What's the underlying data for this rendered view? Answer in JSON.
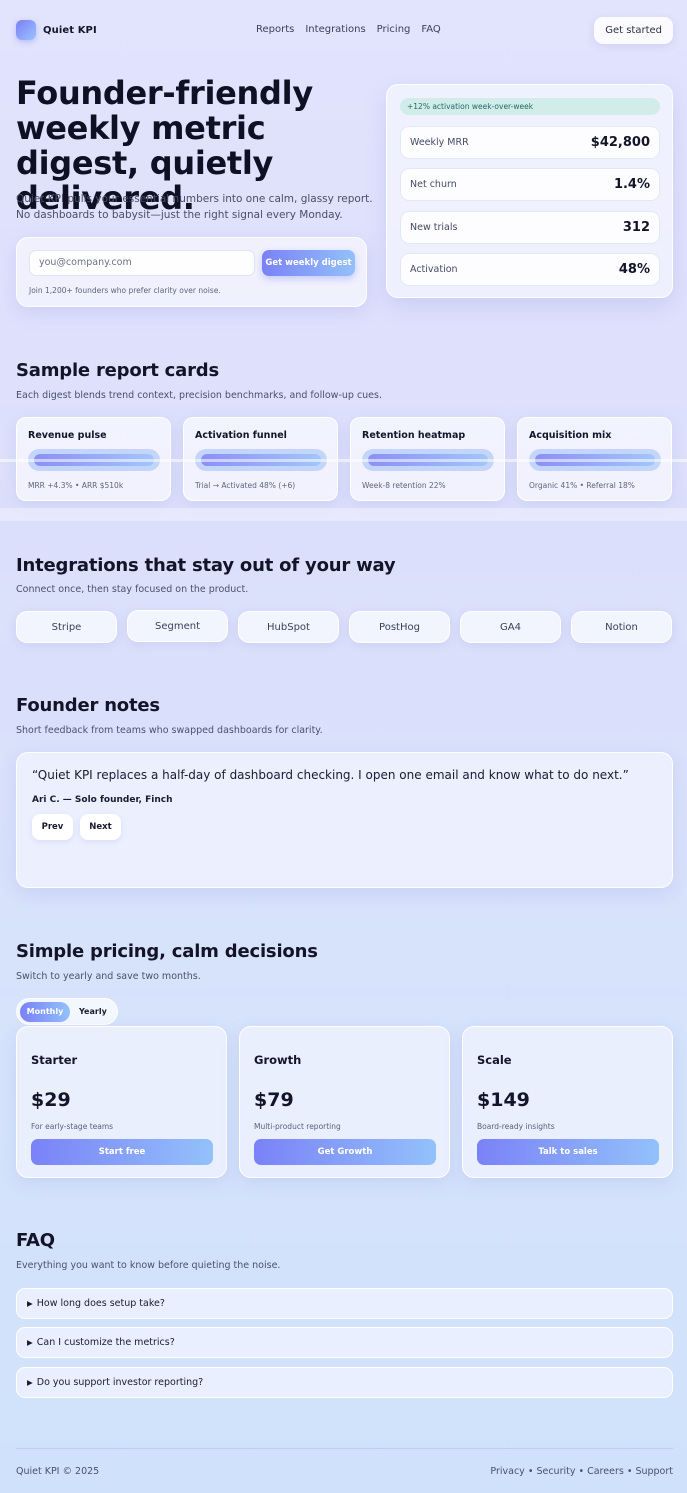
{
  "header": {
    "brand": "Quiet KPI",
    "nav": [
      "Reports",
      "Integrations",
      "Pricing",
      "FAQ"
    ],
    "cta": "Get started"
  },
  "hero": {
    "title": "Founder-friendly weekly metric digest, quietly delivered.",
    "subtitle": "Quiet KPI pulls your essential numbers into one calm, glassy report. No dashboards to babysit—just the right signal every Monday.",
    "email_placeholder": "you@company.com",
    "button": "Get weekly digest",
    "note": "Join 1,200+ founders who prefer clarity over noise."
  },
  "metrics": {
    "badge": "+12% activation week-over-week",
    "rows": [
      {
        "label": "Weekly MRR",
        "value": "$42,800"
      },
      {
        "label": "Net churn",
        "value": "1.4%"
      },
      {
        "label": "New trials",
        "value": "312"
      },
      {
        "label": "Activation",
        "value": "48%"
      }
    ]
  },
  "reports": {
    "title": "Sample report cards",
    "subtitle": "Each digest blends trend context, precision benchmarks, and follow-up cues.",
    "cards": [
      {
        "title": "Revenue pulse",
        "desc": "MRR +4.3% • ARR $510k"
      },
      {
        "title": "Activation funnel",
        "desc": "Trial → Activated 48% (+6)"
      },
      {
        "title": "Retention heatmap",
        "desc": "Week-8 retention 22%"
      },
      {
        "title": "Acquisition mix",
        "desc": "Organic 41% • Referral 18%"
      }
    ]
  },
  "integrations": {
    "title": "Integrations that stay out of your way",
    "subtitle": "Connect once, then stay focused on the product.",
    "items": [
      "Stripe",
      "Segment",
      "HubSpot",
      "PostHog",
      "GA4",
      "Notion"
    ]
  },
  "notes": {
    "title": "Founder notes",
    "subtitle": "Short feedback from teams who swapped dashboards for clarity.",
    "quote": "“Quiet KPI replaces a half-day of dashboard checking. I open one email and know what to do next.”",
    "author": "Ari C. — Solo founder, Finch",
    "prev": "Prev",
    "next": "Next"
  },
  "pricing": {
    "title": "Simple pricing, calm decisions",
    "subtitle": "Switch to yearly and save two months.",
    "toggle": {
      "monthly": "Monthly",
      "yearly": "Yearly"
    },
    "plans": [
      {
        "name": "Starter",
        "price": "$29",
        "desc": "For early-stage teams",
        "button": "Start free"
      },
      {
        "name": "Growth",
        "price": "$79",
        "desc": "Multi-product reporting",
        "button": "Get Growth"
      },
      {
        "name": "Scale",
        "price": "$149",
        "desc": "Board-ready insights",
        "button": "Talk to sales"
      }
    ]
  },
  "faq": {
    "title": "FAQ",
    "subtitle": "Everything you want to know before quieting the noise.",
    "arrow": "▶",
    "items": [
      "How long does setup take?",
      "Can I customize the metrics?",
      "Do you support investor reporting?"
    ]
  },
  "footer": {
    "copyright": "Quiet KPI © 2025",
    "links": "Privacy • Security • Careers • Support"
  }
}
